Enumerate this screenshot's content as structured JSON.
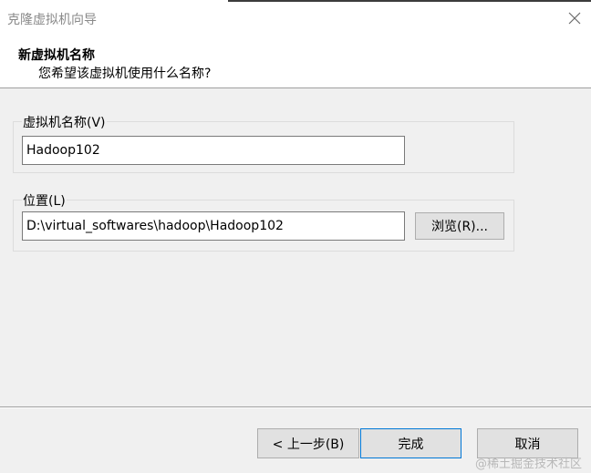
{
  "window": {
    "title": "克隆虚拟机向导",
    "close_icon": "close-icon"
  },
  "header": {
    "heading": "新虚拟机名称",
    "subheading": "您希望该虚拟机使用什么名称?"
  },
  "name_group": {
    "label": "虚拟机名称(V)",
    "value": "Hadoop102"
  },
  "location_group": {
    "label": "位置(L)",
    "value": "D:\\virtual_softwares\\hadoop\\Hadoop102",
    "browse_label": "浏览(R)..."
  },
  "footer": {
    "back_label": "< 上一步(B)",
    "finish_label": "完成",
    "cancel_label": "取消"
  },
  "watermark": "@稀土掘金技术社区"
}
